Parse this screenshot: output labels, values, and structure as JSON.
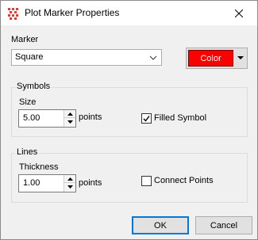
{
  "window": {
    "title": "Plot Marker Properties"
  },
  "marker": {
    "label": "Marker",
    "selected": "Square",
    "color_label": "Color",
    "color_value": "#ff0000"
  },
  "symbols": {
    "group_title": "Symbols",
    "size_label": "Size",
    "size_value": "5.00",
    "unit": "points",
    "filled_label": "Filled Symbol",
    "filled_checked": true
  },
  "lines": {
    "group_title": "Lines",
    "thickness_label": "Thickness",
    "thickness_value": "1.00",
    "unit": "points",
    "connect_label": "Connect Points",
    "connect_checked": false
  },
  "buttons": {
    "ok": "OK",
    "cancel": "Cancel"
  }
}
